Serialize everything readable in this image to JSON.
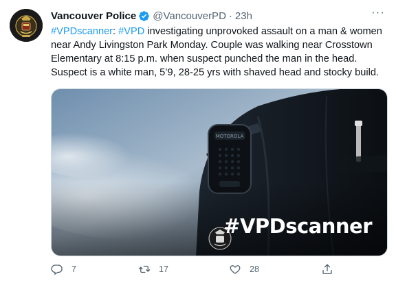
{
  "account": {
    "name": "Vancouver Police",
    "handle": "@VancouverPD",
    "separator": "·",
    "time": "23h"
  },
  "tweet": {
    "tag1": "#VPDscanner",
    "colon": ": ",
    "tag2": "#VPD",
    "body": " investigating unprovoked assault on a man & women near Andy Livingston Park Monday. Couple was walking near Crosstown Elementary at 8:15 p.m. when suspect punched the man in the head. Suspect is a white man, 5’9, 28-25 yrs with shaved head and stocky build."
  },
  "media": {
    "caption": "#VPDscanner"
  },
  "actions": {
    "reply_count": "7",
    "retweet_count": "17",
    "like_count": "28"
  },
  "colors": {
    "link": "#1d9bf0",
    "muted": "#536471",
    "verified": "#1d9bf0"
  }
}
